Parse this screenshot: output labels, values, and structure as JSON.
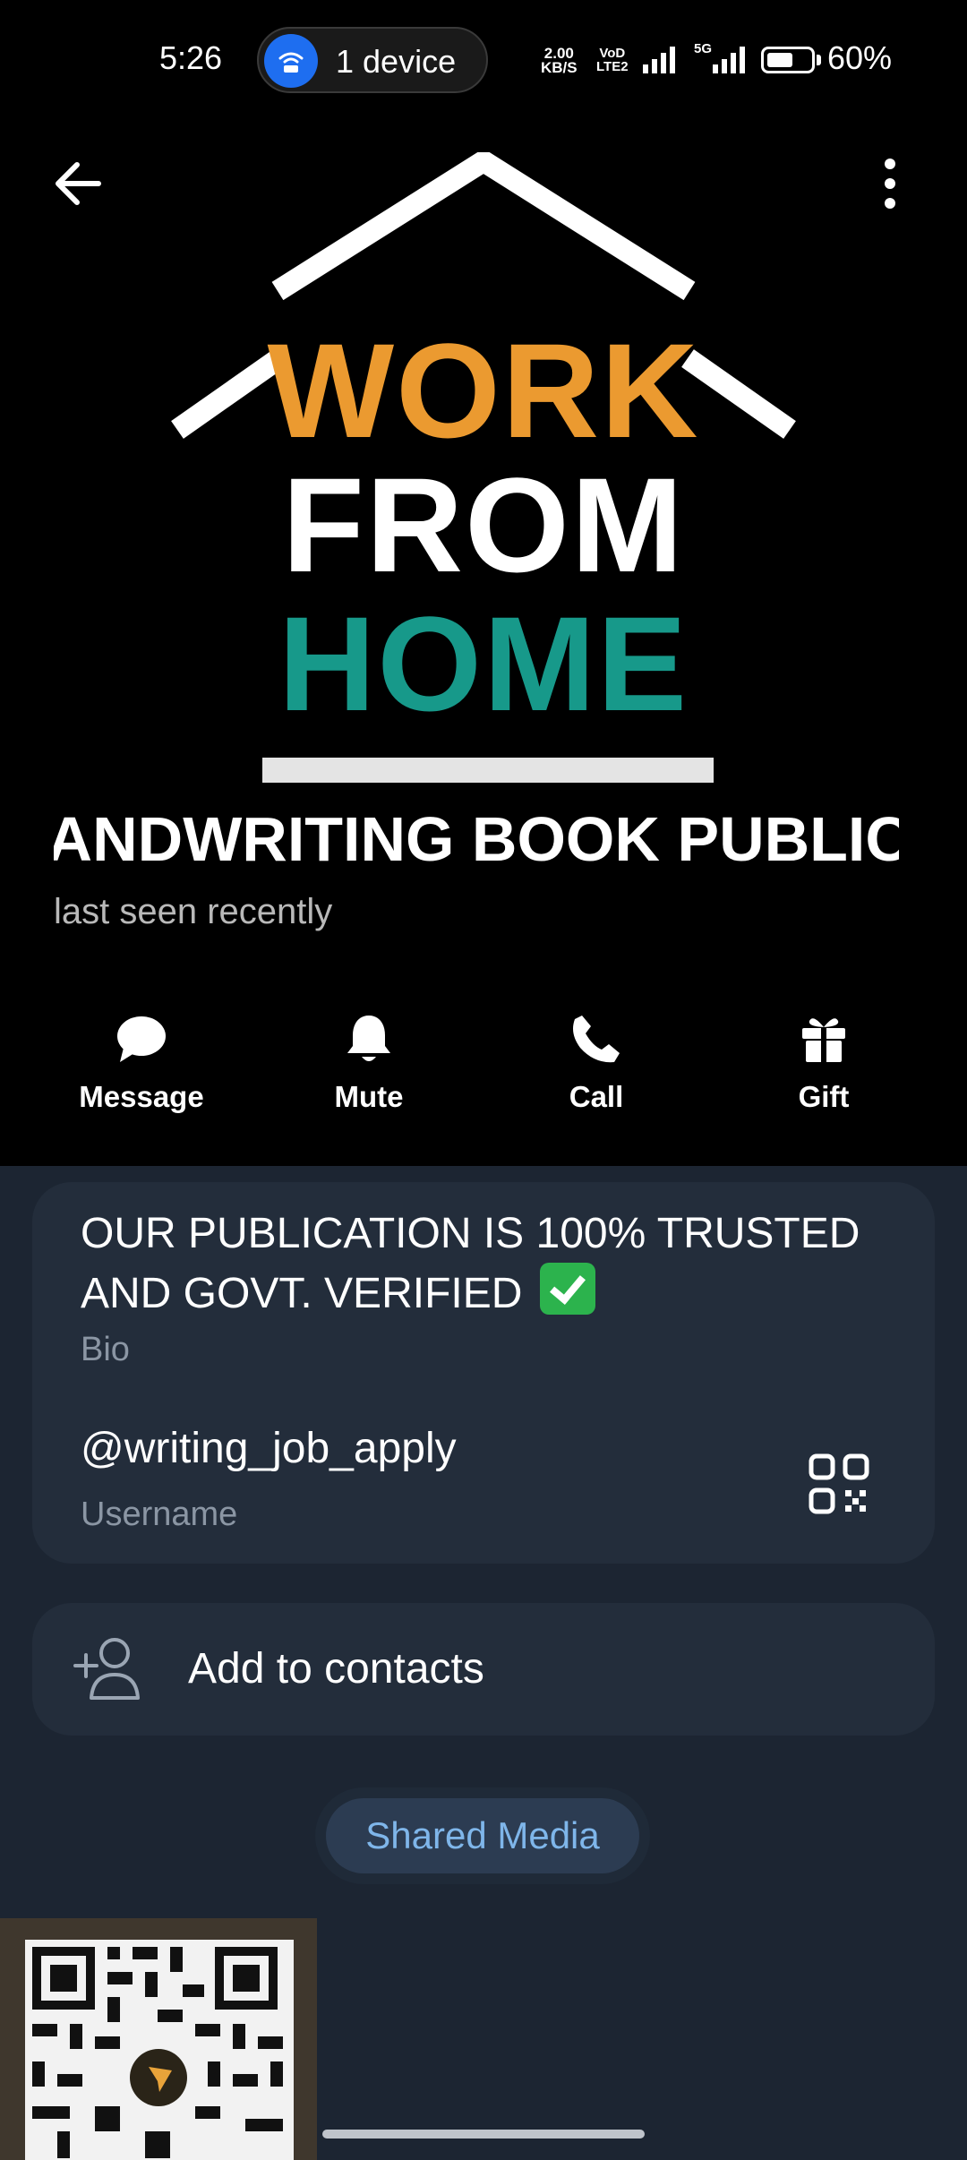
{
  "status_bar": {
    "time": "5:26",
    "hotspot_label": "1 device",
    "net_speed_value": "2.00",
    "net_speed_unit": "KB/S",
    "volte_top": "VoD",
    "volte_bottom": "LTE2",
    "network_type": "5G",
    "battery_percent": "60%",
    "battery_level": 0.6
  },
  "header": {
    "logo_lines": [
      "WORK",
      "FROM",
      "HOME"
    ],
    "profile_name": "HANDWRITING BOOK PUBLICATION",
    "last_seen": "last seen recently"
  },
  "actions": [
    {
      "label": "Message",
      "icon": "message-icon"
    },
    {
      "label": "Mute",
      "icon": "bell-icon"
    },
    {
      "label": "Call",
      "icon": "phone-icon"
    },
    {
      "label": "Gift",
      "icon": "gift-icon"
    }
  ],
  "info": {
    "bio_text": "OUR PUBLICATION IS 100% TRUSTED AND GOVT. VERIFIED",
    "bio_label": "Bio",
    "username": "@writing_job_apply",
    "username_label": "Username"
  },
  "add_contact": {
    "label": "Add to contacts"
  },
  "shared_media": {
    "label": "Shared Media"
  },
  "colors": {
    "background": "#1c2532",
    "card": "#232d3b",
    "accent_orange": "#eb9a30",
    "accent_teal": "#17998a",
    "link_blue": "#7fb6ea"
  }
}
